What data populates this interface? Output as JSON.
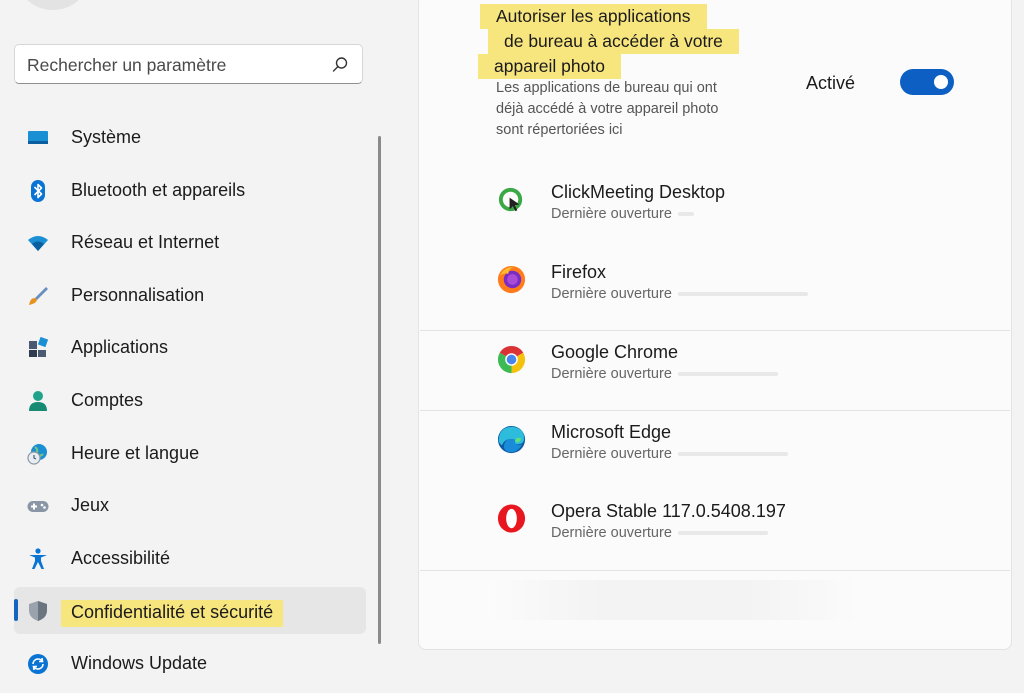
{
  "search": {
    "placeholder": "Rechercher un paramètre",
    "icon": "search-icon"
  },
  "sidebar": {
    "items": [
      {
        "label": "Système",
        "icon": "monitor-icon"
      },
      {
        "label": "Bluetooth et appareils",
        "icon": "bluetooth-icon"
      },
      {
        "label": "Réseau et Internet",
        "icon": "wifi-icon"
      },
      {
        "label": "Personnalisation",
        "icon": "brush-icon"
      },
      {
        "label": "Applications",
        "icon": "apps-icon"
      },
      {
        "label": "Comptes",
        "icon": "person-icon"
      },
      {
        "label": "Heure et langue",
        "icon": "globe-clock-icon"
      },
      {
        "label": "Jeux",
        "icon": "gamepad-icon"
      },
      {
        "label": "Accessibilité",
        "icon": "accessibility-icon"
      },
      {
        "label": "Confidentialité et sécurité",
        "icon": "shield-icon",
        "selected": true
      },
      {
        "label": "Windows Update",
        "icon": "update-icon"
      }
    ]
  },
  "permission": {
    "title_lines": [
      "Autoriser les applications",
      "de bureau à accéder à votre",
      "appareil photo"
    ],
    "description": "Les applications de bureau qui ont déjà accédé à votre appareil photo sont répertoriées ici",
    "toggle_label": "Activé",
    "toggle_on": true
  },
  "apps": [
    {
      "name": "ClickMeeting Desktop",
      "last": "Dernière ouverture",
      "icon": "clickmeeting-icon"
    },
    {
      "name": "Firefox",
      "last": "Dernière ouverture",
      "icon": "firefox-icon"
    },
    {
      "name": "Google Chrome",
      "last": "Dernière ouverture",
      "icon": "chrome-icon"
    },
    {
      "name": "Microsoft Edge",
      "last": "Dernière ouverture",
      "icon": "edge-icon"
    },
    {
      "name": "Opera Stable 117.0.5408.197",
      "last": "Dernière ouverture",
      "icon": "opera-icon"
    }
  ],
  "colors": {
    "accent": "#0e5fc4",
    "highlight": "#f7e57e"
  }
}
